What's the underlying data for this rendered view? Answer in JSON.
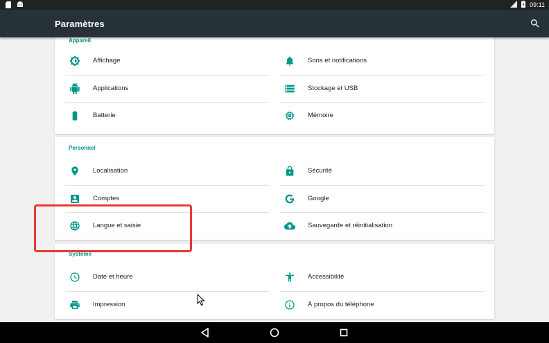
{
  "statusbar": {
    "time": "09:11",
    "icons": [
      "sd-card-icon",
      "android-icon",
      "network-icon",
      "battery-icon"
    ]
  },
  "appbar": {
    "title": "Paramètres",
    "icon": "search-icon"
  },
  "sections": [
    {
      "title": "Appareil",
      "items": [
        {
          "label": "Affichage",
          "icon": "brightness-icon"
        },
        {
          "label": "Sons et notifications",
          "icon": "bell-icon"
        },
        {
          "label": "Applications",
          "icon": "android-icon"
        },
        {
          "label": "Stockage et USB",
          "icon": "storage-icon"
        },
        {
          "label": "Batterie",
          "icon": "battery-icon"
        },
        {
          "label": "Mémoire",
          "icon": "memory-icon"
        }
      ]
    },
    {
      "title": "Personnel",
      "items": [
        {
          "label": "Localisation",
          "icon": "location-pin-icon"
        },
        {
          "label": "Sécurité",
          "icon": "lock-icon"
        },
        {
          "label": "Comptes",
          "icon": "account-box-icon"
        },
        {
          "label": "Google",
          "icon": "google-g-icon"
        },
        {
          "label": "Langue et saisie",
          "icon": "globe-icon"
        },
        {
          "label": "Sauvegarde et réinitialisation",
          "icon": "cloud-upload-icon"
        }
      ]
    },
    {
      "title": "Système",
      "items": [
        {
          "label": "Date et heure",
          "icon": "clock-icon"
        },
        {
          "label": "Accessibilité",
          "icon": "accessibility-icon"
        },
        {
          "label": "Impression",
          "icon": "printer-icon"
        },
        {
          "label": "À propos du téléphone",
          "icon": "info-icon"
        }
      ]
    }
  ],
  "navbar": {
    "buttons": [
      "back-icon",
      "home-icon",
      "recents-icon"
    ]
  },
  "colors": {
    "accent": "#009688",
    "appbar": "#263238",
    "highlight": "#e53935"
  }
}
